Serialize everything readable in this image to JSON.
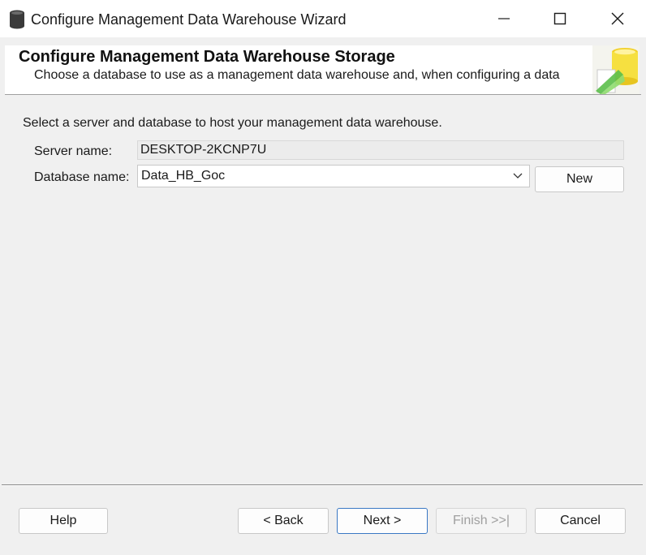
{
  "window": {
    "title": "Configure Management Data Warehouse Wizard",
    "app_icon": "database-icon",
    "controls": [
      "minimize-icon",
      "maximize-icon",
      "close-icon"
    ]
  },
  "header": {
    "title": "Configure Management Data Warehouse Storage",
    "subtitle": "Choose a database to use as a management data warehouse and, when configuring a data",
    "art_icon": "database-wizard-icon"
  },
  "form": {
    "instruction": "Select a server and database to host your management data warehouse.",
    "server_label": "Server name:",
    "server_value": "DESKTOP-2KCNP7U",
    "database_label": "Database name:",
    "database_value": "Data_HB_Goc",
    "new_button": "New"
  },
  "footer": {
    "help": "Help",
    "back": "< Back",
    "next": "Next >",
    "finish": "Finish >>|",
    "cancel": "Cancel"
  },
  "colors": {
    "background": "#f0f0f0",
    "accent_border": "#3a78c4",
    "disabled_text": "#a0a0a0"
  }
}
